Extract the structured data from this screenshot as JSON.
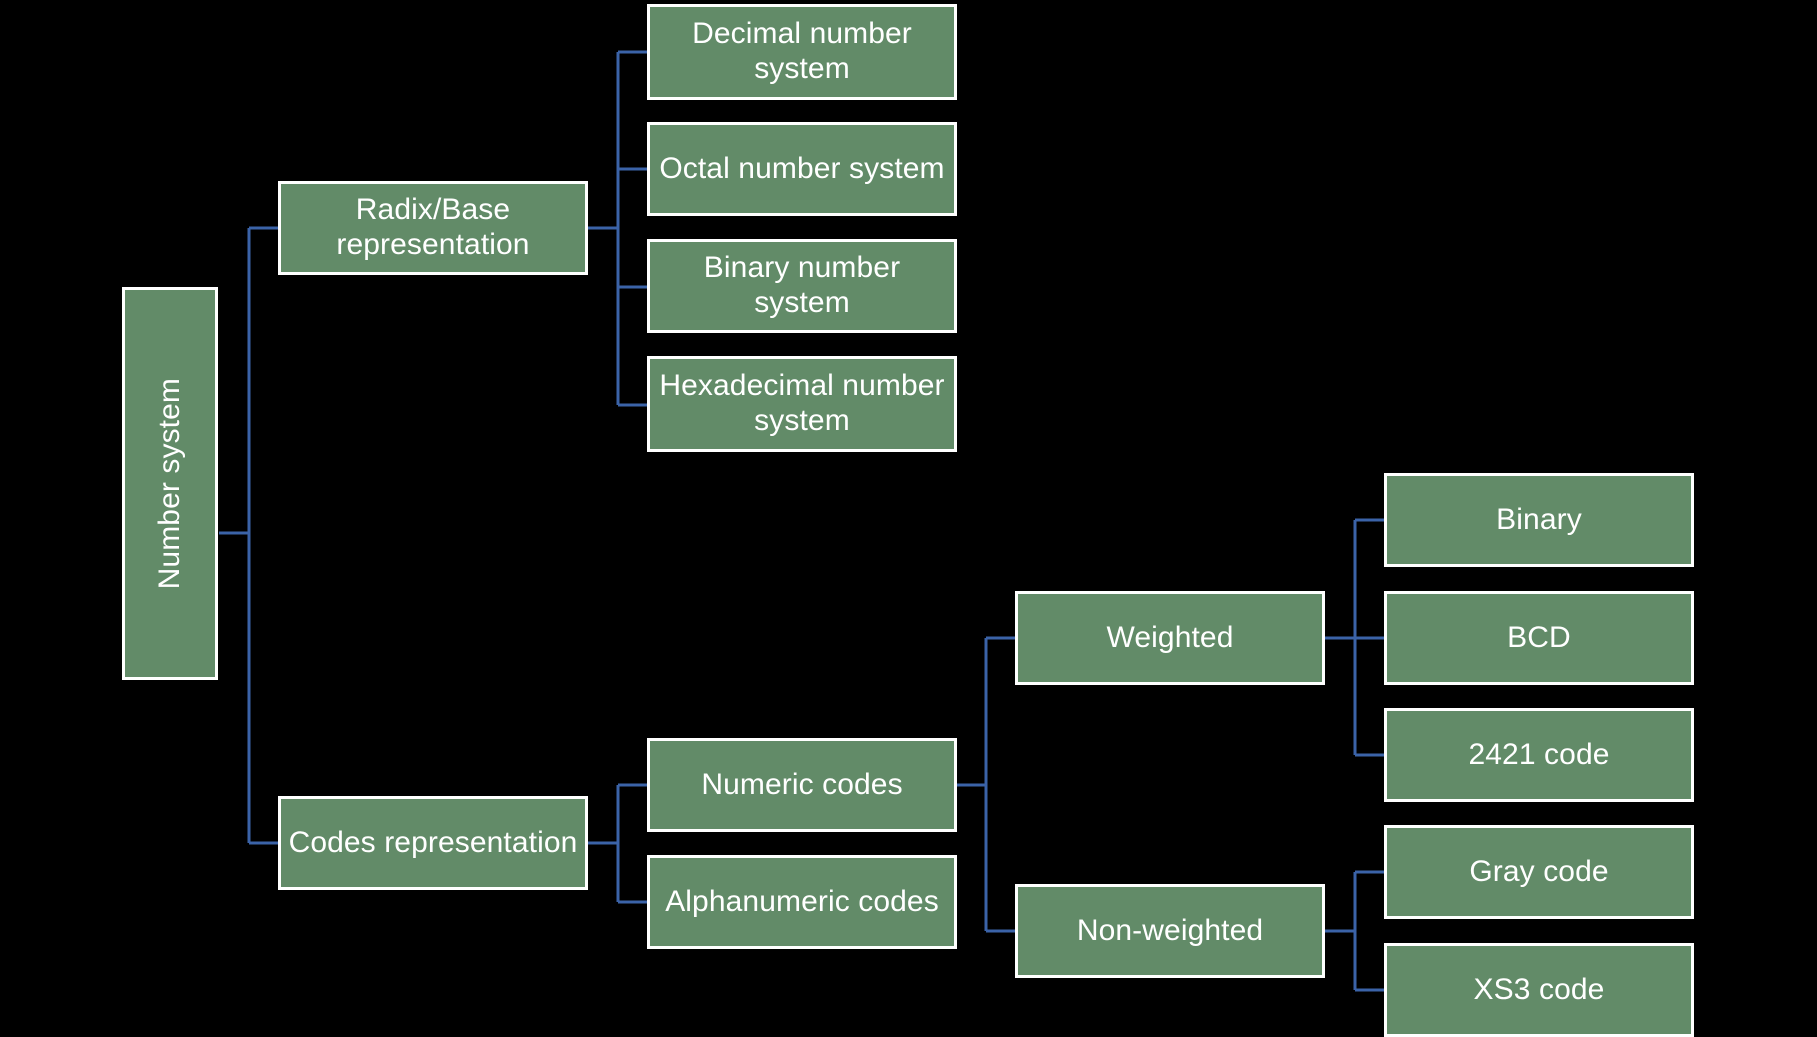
{
  "diagram": {
    "title": "Number system classification tree",
    "type": "hierarchy-tree",
    "colors": {
      "background": "#000000",
      "node_fill": "#628B68",
      "node_border": "#ffffff",
      "node_text": "#ffffff",
      "connector": "#3B63A8"
    }
  },
  "nodes": {
    "root": {
      "label": "Number system"
    },
    "level1": [
      {
        "label": "Radix/Base\nrepresentation"
      },
      {
        "label": "Codes representation"
      }
    ],
    "radix_children": [
      {
        "label": "Decimal number\nsystem"
      },
      {
        "label": "Octal number system"
      },
      {
        "label": "Binary number system"
      },
      {
        "label": "Hexadecimal number\nsystem"
      }
    ],
    "codes_children": [
      {
        "label": "Numeric codes"
      },
      {
        "label": "Alphanumeric codes"
      }
    ],
    "numeric_children": [
      {
        "label": "Weighted"
      },
      {
        "label": "Non-weighted"
      }
    ],
    "weighted_children": [
      {
        "label": "Binary"
      },
      {
        "label": "BCD"
      },
      {
        "label": "2421 code"
      }
    ],
    "nonweighted_children": [
      {
        "label": "Gray code"
      },
      {
        "label": "XS3 code"
      }
    ]
  }
}
